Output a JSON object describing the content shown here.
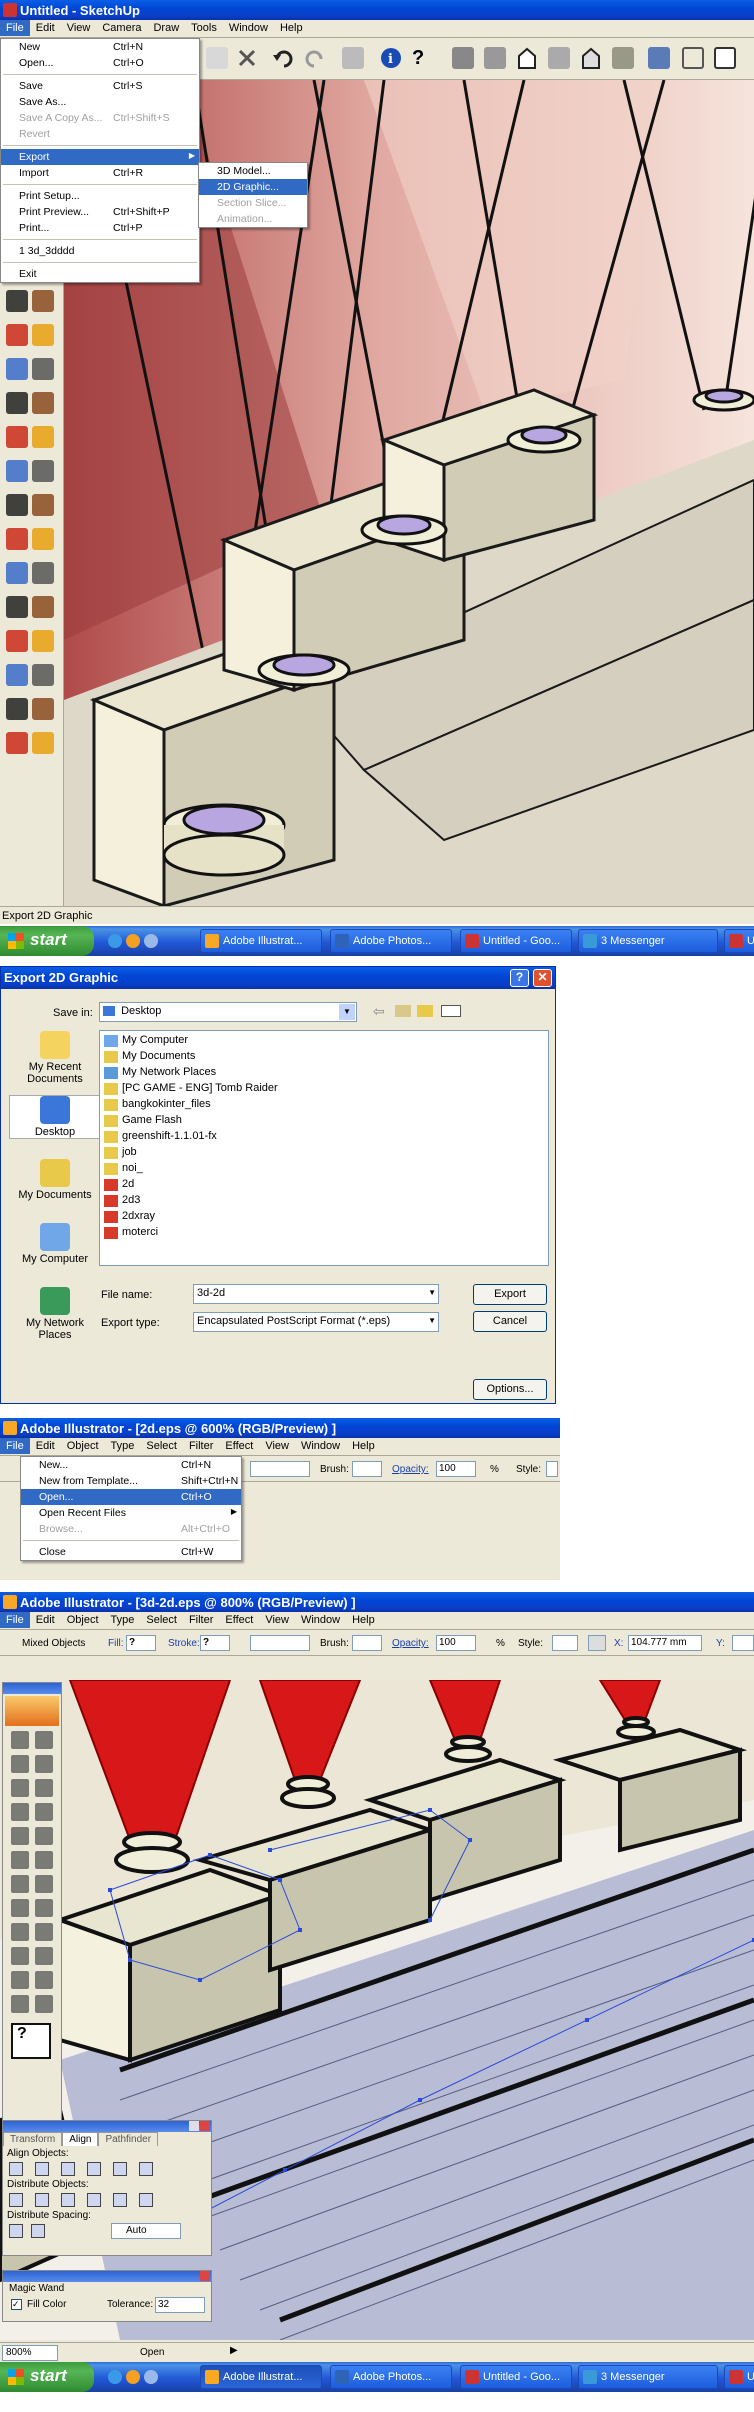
{
  "sketchup": {
    "title": "Untitled - SketchUp",
    "menus": [
      "File",
      "Edit",
      "View",
      "Camera",
      "Draw",
      "Tools",
      "Window",
      "Help"
    ],
    "file_menu": [
      {
        "label": "New",
        "shortcut": "Ctrl+N",
        "disabled": false
      },
      {
        "label": "Open...",
        "shortcut": "Ctrl+O",
        "disabled": false
      },
      {
        "sep": true
      },
      {
        "label": "Save",
        "shortcut": "Ctrl+S",
        "disabled": false
      },
      {
        "label": "Save As...",
        "shortcut": "",
        "disabled": false
      },
      {
        "label": "Save A Copy As...",
        "shortcut": "Ctrl+Shift+S",
        "disabled": true
      },
      {
        "label": "Revert",
        "shortcut": "",
        "disabled": true
      },
      {
        "sep": true
      },
      {
        "label": "Export",
        "shortcut": "",
        "disabled": false,
        "selected": true,
        "submenu": true
      },
      {
        "label": "Import",
        "shortcut": "Ctrl+R",
        "disabled": false
      },
      {
        "sep": true
      },
      {
        "label": "Print Setup...",
        "shortcut": "",
        "disabled": false
      },
      {
        "label": "Print Preview...",
        "shortcut": "Ctrl+Shift+P",
        "disabled": false
      },
      {
        "label": "Print...",
        "shortcut": "Ctrl+P",
        "disabled": false
      },
      {
        "sep": true
      },
      {
        "label": "1 3d_3dddd",
        "shortcut": "",
        "disabled": false
      },
      {
        "sep": true
      },
      {
        "label": "Exit",
        "shortcut": "",
        "disabled": false
      }
    ],
    "export_submenu": [
      {
        "label": "3D Model...",
        "disabled": false
      },
      {
        "label": "2D Graphic...",
        "disabled": false,
        "selected": true
      },
      {
        "label": "Section Slice...",
        "disabled": true
      },
      {
        "label": "Animation...",
        "disabled": true
      }
    ],
    "status_text": "Export 2D Graphic"
  },
  "taskbar1": {
    "start": "start",
    "buttons": [
      "Adobe Illustrat...",
      "Adobe Photos...",
      "Untitled - Goo...",
      "3 Messenger",
      "Unt"
    ]
  },
  "export_dialog": {
    "title": "Export 2D Graphic",
    "save_in_label": "Save in:",
    "save_in_value": "Desktop",
    "places": [
      "My Recent Documents",
      "Desktop",
      "My Documents",
      "My Computer",
      "My Network Places"
    ],
    "files": [
      {
        "name": "My Computer",
        "kind": "computer"
      },
      {
        "name": "My Documents",
        "kind": "folder"
      },
      {
        "name": "My Network Places",
        "kind": "network"
      },
      {
        "name": "[PC GAME - ENG] Tomb Raider",
        "kind": "folder"
      },
      {
        "name": "bangkokinter_files",
        "kind": "folder"
      },
      {
        "name": "Game Flash",
        "kind": "folder"
      },
      {
        "name": "greenshift-1.1.01-fx",
        "kind": "folder"
      },
      {
        "name": "job",
        "kind": "folder"
      },
      {
        "name": "noi_",
        "kind": "folder"
      },
      {
        "name": "2d",
        "kind": "eps"
      },
      {
        "name": "2d3",
        "kind": "eps"
      },
      {
        "name": "2dxray",
        "kind": "eps"
      },
      {
        "name": "moterci",
        "kind": "eps"
      }
    ],
    "file_name_label": "File name:",
    "file_name_value": "3d-2d",
    "export_type_label": "Export type:",
    "export_type_value": "Encapsulated PostScript Format (*.eps)",
    "export_button": "Export",
    "cancel_button": "Cancel",
    "options_button": "Options..."
  },
  "illustrator1": {
    "title": "Adobe Illustrator - [2d.eps @ 600% (RGB/Preview) ]",
    "menus": [
      "File",
      "Edit",
      "Object",
      "Type",
      "Select",
      "Filter",
      "Effect",
      "View",
      "Window",
      "Help"
    ],
    "file_menu": [
      {
        "label": "New...",
        "shortcut": "Ctrl+N",
        "disabled": false
      },
      {
        "label": "New from Template...",
        "shortcut": "Shift+Ctrl+N",
        "disabled": false
      },
      {
        "label": "Open...",
        "shortcut": "Ctrl+O",
        "disabled": false,
        "selected": true
      },
      {
        "label": "Open Recent Files",
        "shortcut": "",
        "disabled": false,
        "submenu": true
      },
      {
        "label": "Browse...",
        "shortcut": "Alt+Ctrl+O",
        "disabled": true
      },
      {
        "sep": true
      },
      {
        "label": "Close",
        "shortcut": "Ctrl+W",
        "disabled": false
      }
    ],
    "brush_label": "Brush:",
    "opacity_label": "Opacity:",
    "opacity_value": "100",
    "percent": "%",
    "style_label": "Style:"
  },
  "illustrator2": {
    "title": "Adobe Illustrator - [3d-2d.eps @ 800% (RGB/Preview) ]",
    "menus": [
      "File",
      "Edit",
      "Object",
      "Type",
      "Select",
      "Filter",
      "Effect",
      "View",
      "Window",
      "Help"
    ],
    "control": {
      "mixed": "Mixed Objects",
      "fill_label": "Fill:",
      "stroke_label": "Stroke:",
      "brush_label": "Brush:",
      "opacity_label": "Opacity:",
      "opacity_value": "100",
      "percent": "%",
      "style_label": "Style:",
      "x_label": "X:",
      "x_value": "104.777 mm",
      "y_label": "Y:"
    },
    "align_panel": {
      "tabs": [
        "Transform",
        "Align",
        "Pathfinder"
      ],
      "align_objects": "Align Objects:",
      "distribute_objects": "Distribute Objects:",
      "distribute_spacing": "Distribute Spacing:",
      "spacing_value": "Auto"
    },
    "magic_wand": {
      "title": "Magic Wand",
      "fill_color": "Fill Color",
      "tolerance_label": "Tolerance:",
      "tolerance_value": "32"
    },
    "status": {
      "zoom": "800%",
      "tool": "Open"
    }
  },
  "taskbar2": {
    "start": "start",
    "buttons": [
      "Adobe Illustrat...",
      "Adobe Photos...",
      "Untitled - Goo...",
      "3 Messenger",
      "Unt"
    ]
  },
  "colors": {
    "xp_blue": "#0a5ee6",
    "menu_highlight": "#316ac5",
    "start_green": "#3c9c3c",
    "cone_red": "#d81818"
  }
}
